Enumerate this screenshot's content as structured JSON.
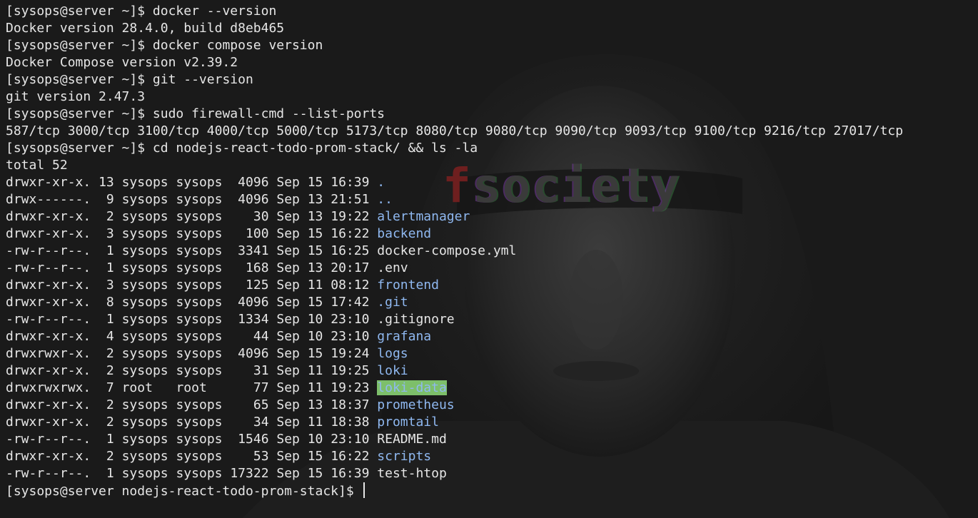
{
  "terminal": {
    "prompt_home": "[sysops@server ~]$ ",
    "prompt_project": "[sysops@server nodejs-react-todo-prom-stack]$ ",
    "history": [
      {
        "cmd": "docker --version",
        "out": "Docker version 28.4.0, build d8eb465"
      },
      {
        "cmd": "docker compose version",
        "out": "Docker Compose version v2.39.2"
      },
      {
        "cmd": "git --version",
        "out": "git version 2.47.3"
      },
      {
        "cmd": "sudo firewall-cmd --list-ports",
        "out": "587/tcp 3000/tcp 3100/tcp 4000/tcp 5000/tcp 5173/tcp 8080/tcp 9080/tcp 9090/tcp 9093/tcp 9100/tcp 9216/tcp 27017/tcp"
      },
      {
        "cmd": "cd nodejs-react-todo-prom-stack/ && ls -la",
        "out": "total 52"
      }
    ],
    "listing": [
      {
        "perm": "drwxr-xr-x.",
        "links": "13",
        "owner": "sysops",
        "group": "sysops",
        "size": "4096",
        "date": "Sep 15 16:39",
        "name": ".",
        "type": "dir"
      },
      {
        "perm": "drwx------.",
        "links": "9",
        "owner": "sysops",
        "group": "sysops",
        "size": "4096",
        "date": "Sep 13 21:51",
        "name": "..",
        "type": "dir"
      },
      {
        "perm": "drwxr-xr-x.",
        "links": "2",
        "owner": "sysops",
        "group": "sysops",
        "size": "30",
        "date": "Sep 13 19:22",
        "name": "alertmanager",
        "type": "dir"
      },
      {
        "perm": "drwxr-xr-x.",
        "links": "3",
        "owner": "sysops",
        "group": "sysops",
        "size": "100",
        "date": "Sep 15 16:22",
        "name": "backend",
        "type": "dir"
      },
      {
        "perm": "-rw-r--r--.",
        "links": "1",
        "owner": "sysops",
        "group": "sysops",
        "size": "3341",
        "date": "Sep 15 16:25",
        "name": "docker-compose.yml",
        "type": "file"
      },
      {
        "perm": "-rw-r--r--.",
        "links": "1",
        "owner": "sysops",
        "group": "sysops",
        "size": "168",
        "date": "Sep 13 20:17",
        "name": ".env",
        "type": "file"
      },
      {
        "perm": "drwxr-xr-x.",
        "links": "3",
        "owner": "sysops",
        "group": "sysops",
        "size": "125",
        "date": "Sep 11 08:12",
        "name": "frontend",
        "type": "dir"
      },
      {
        "perm": "drwxr-xr-x.",
        "links": "8",
        "owner": "sysops",
        "group": "sysops",
        "size": "4096",
        "date": "Sep 15 17:42",
        "name": ".git",
        "type": "dir"
      },
      {
        "perm": "-rw-r--r--.",
        "links": "1",
        "owner": "sysops",
        "group": "sysops",
        "size": "1334",
        "date": "Sep 10 23:10",
        "name": ".gitignore",
        "type": "file"
      },
      {
        "perm": "drwxr-xr-x.",
        "links": "4",
        "owner": "sysops",
        "group": "sysops",
        "size": "44",
        "date": "Sep 10 23:10",
        "name": "grafana",
        "type": "dir"
      },
      {
        "perm": "drwxrwxr-x.",
        "links": "2",
        "owner": "sysops",
        "group": "sysops",
        "size": "4096",
        "date": "Sep 15 19:24",
        "name": "logs",
        "type": "dir"
      },
      {
        "perm": "drwxr-xr-x.",
        "links": "2",
        "owner": "sysops",
        "group": "sysops",
        "size": "31",
        "date": "Sep 11 19:25",
        "name": "loki",
        "type": "dir"
      },
      {
        "perm": "drwxrwxrwx.",
        "links": "7",
        "owner": "root",
        "group": "root",
        "size": "77",
        "date": "Sep 11 19:23",
        "name": "loki-data",
        "type": "sticky"
      },
      {
        "perm": "drwxr-xr-x.",
        "links": "2",
        "owner": "sysops",
        "group": "sysops",
        "size": "65",
        "date": "Sep 13 18:37",
        "name": "prometheus",
        "type": "dir"
      },
      {
        "perm": "drwxr-xr-x.",
        "links": "2",
        "owner": "sysops",
        "group": "sysops",
        "size": "34",
        "date": "Sep 11 18:38",
        "name": "promtail",
        "type": "dir"
      },
      {
        "perm": "-rw-r--r--.",
        "links": "1",
        "owner": "sysops",
        "group": "sysops",
        "size": "1546",
        "date": "Sep 10 23:10",
        "name": "README.md",
        "type": "file"
      },
      {
        "perm": "drwxr-xr-x.",
        "links": "2",
        "owner": "sysops",
        "group": "sysops",
        "size": "53",
        "date": "Sep 15 16:22",
        "name": "scripts",
        "type": "dir"
      },
      {
        "perm": "-rw-r--r--.",
        "links": "1",
        "owner": "sysops",
        "group": "sysops",
        "size": "17322",
        "date": "Sep 15 16:39",
        "name": "test-htop",
        "type": "file"
      }
    ]
  },
  "background": {
    "logo_initial": "f",
    "logo_rest": "society"
  },
  "colors": {
    "background": "#1a1a1a",
    "text": "#e6e6e6",
    "directory": "#8fb8f0",
    "sticky_dir_bg": "#7dbf6a",
    "logo_red": "#6e1f1f"
  }
}
